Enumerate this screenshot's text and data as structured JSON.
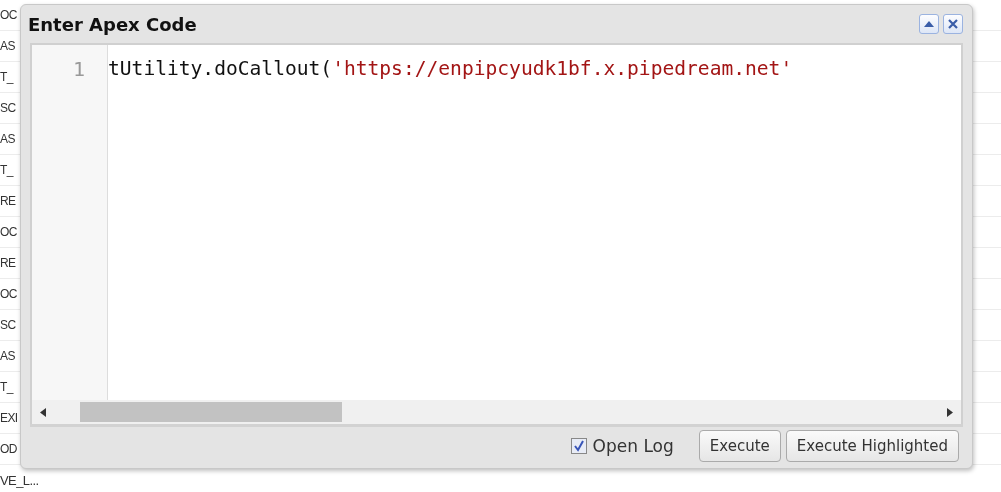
{
  "background_list": {
    "rows": [
      "OC",
      "AS",
      "T_",
      "SC",
      "AS",
      "T_",
      "RE",
      "OC",
      "RE",
      "OC",
      "SC",
      "AS",
      "T_",
      "EXI",
      "OD",
      "VE_L..."
    ]
  },
  "dialog": {
    "title": "Enter Apex Code",
    "editor": {
      "lines": [
        {
          "number": "1",
          "segments": [
            {
              "kind": "plain",
              "text": "tUtility.doCallout("
            },
            {
              "kind": "string",
              "text": "'https://enpipcyudk1bf.x.pipedream.net'"
            }
          ]
        }
      ]
    },
    "open_log": {
      "label": "Open Log",
      "checked": true
    },
    "buttons": [
      "Execute",
      "Execute Highlighted"
    ]
  }
}
